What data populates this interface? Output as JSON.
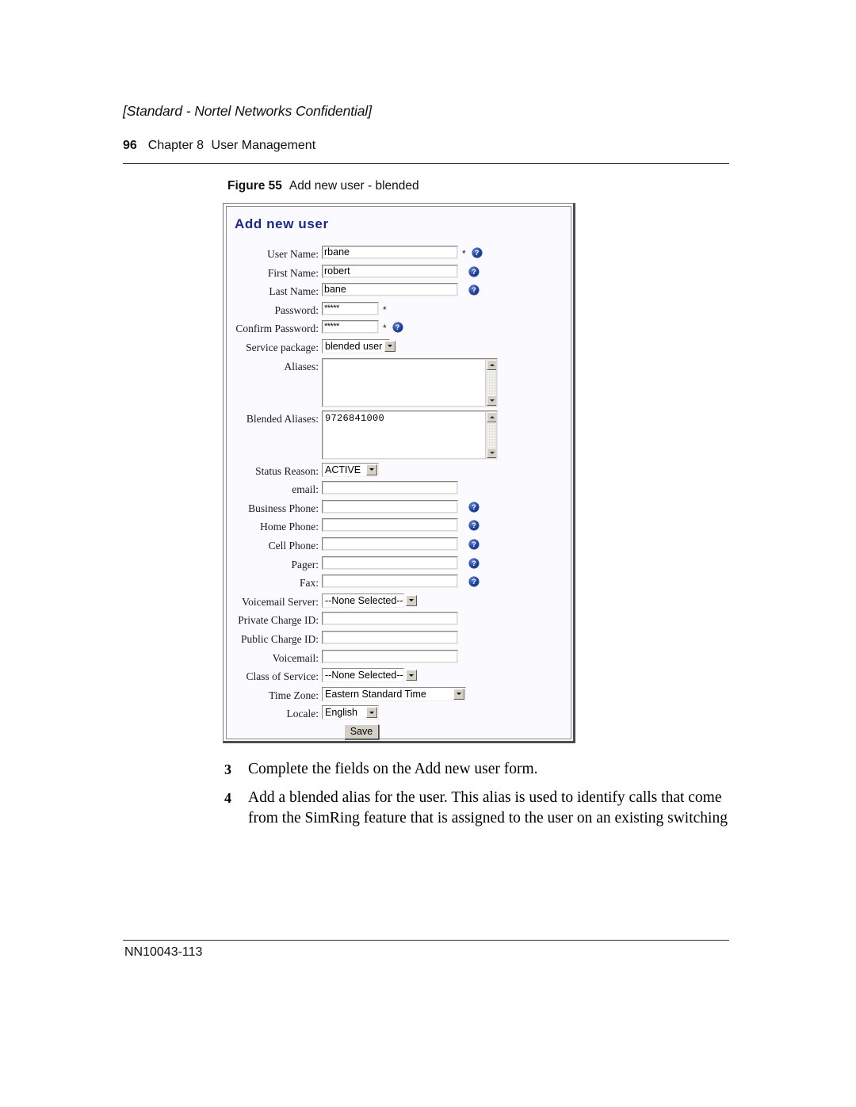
{
  "page": {
    "confidential_notice": "[Standard - Nortel Networks Confidential]",
    "page_number": "96",
    "chapter": "Chapter 8",
    "chapter_title": "User Management",
    "document_number": "NN10043-113"
  },
  "figure": {
    "number": "Figure 55",
    "caption": "Add new user - blended"
  },
  "form": {
    "title": "Add new user",
    "required_marker": "*",
    "help_icon": "help-question-icon",
    "fields": [
      {
        "label": "User Name:",
        "value": "rbane"
      },
      {
        "label": "First Name:",
        "value": "robert"
      },
      {
        "label": "Last Name:",
        "value": "bane"
      },
      {
        "label": "Password:",
        "value": "*****"
      },
      {
        "label": "Confirm Password:",
        "value": "*****"
      },
      {
        "label": "Service package:",
        "value": "blended user"
      },
      {
        "label": "Aliases:",
        "value": ""
      },
      {
        "label": "Blended Aliases:",
        "value": "9726841000"
      },
      {
        "label": "Status Reason:",
        "value": "ACTIVE"
      },
      {
        "label": "email:",
        "value": ""
      },
      {
        "label": "Business Phone:",
        "value": ""
      },
      {
        "label": "Home Phone:",
        "value": ""
      },
      {
        "label": "Cell Phone:",
        "value": ""
      },
      {
        "label": "Pager:",
        "value": ""
      },
      {
        "label": "Fax:",
        "value": ""
      },
      {
        "label": "Voicemail Server:",
        "value": "--None Selected--"
      },
      {
        "label": "Private Charge ID:",
        "value": ""
      },
      {
        "label": "Public Charge ID:",
        "value": ""
      },
      {
        "label": "Voicemail:",
        "value": ""
      },
      {
        "label": "Class of Service:",
        "value": "--None Selected--"
      },
      {
        "label": "Time Zone:",
        "value": "Eastern Standard Time"
      },
      {
        "label": "Locale:",
        "value": "English"
      }
    ],
    "save_label": "Save"
  },
  "steps": [
    {
      "num": "3",
      "text": "Complete the fields on the Add new user form."
    },
    {
      "num": "4",
      "text": "Add a blended alias for the user. This alias is used to identify calls that come from the SimRing feature that is assigned to the user on an existing switching"
    }
  ]
}
